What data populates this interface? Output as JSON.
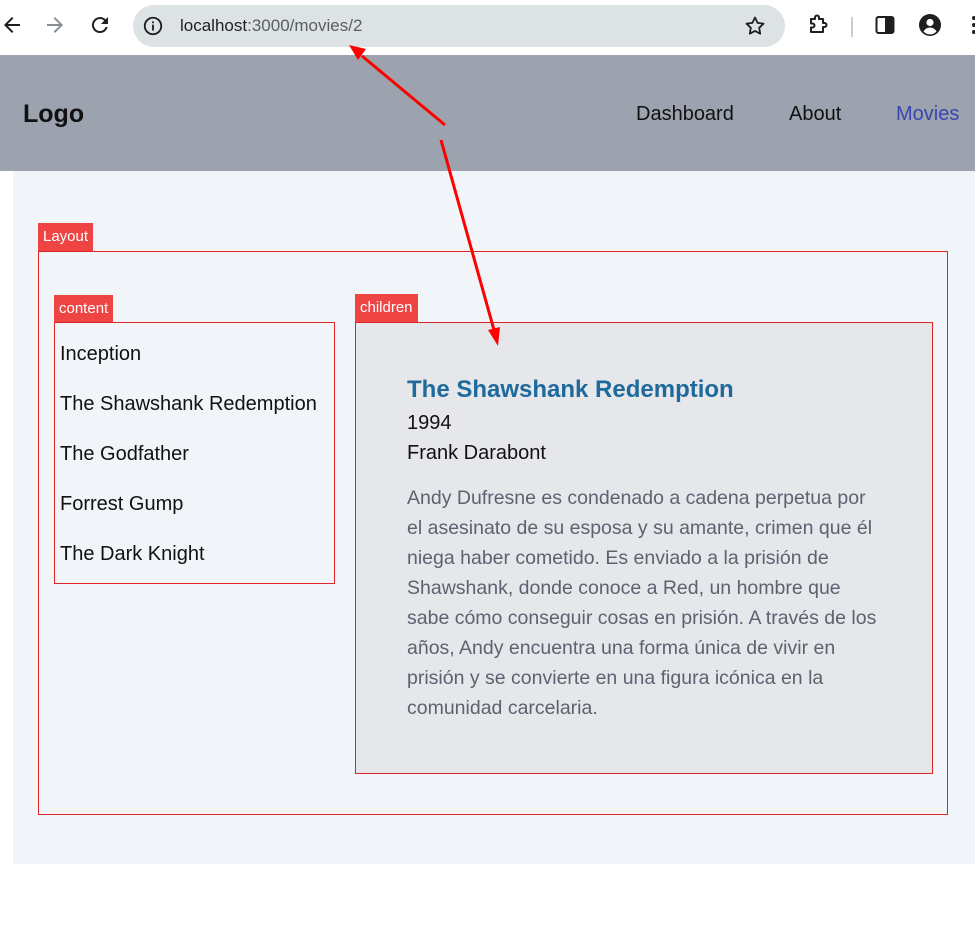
{
  "browser": {
    "url_host": "localhost",
    "url_path": ":3000/movies/2"
  },
  "header": {
    "logo": "Logo",
    "nav": [
      {
        "label": "Dashboard"
      },
      {
        "label": "About"
      },
      {
        "label": "Movies"
      }
    ]
  },
  "layout": {
    "layout_tag": "Layout",
    "content_tag": "content",
    "children_tag": "children"
  },
  "movie_list": [
    "Inception",
    "The Shawshank Redemption",
    "The Godfather",
    "Forrest Gump",
    "The Dark Knight"
  ],
  "movie_detail": {
    "title": "The Shawshank Redemption",
    "year": "1994",
    "director": "Frank Darabont",
    "description": "Andy Dufresne es condenado a cadena perpetua por el asesinato de su esposa y su amante, crimen que él niega haber cometido. Es enviado a la prisión de Shawshank, donde conoce a Red, un hombre que sabe cómo conseguir cosas en prisión. A través de los años, Andy encuentra una forma única de vivir en prisión y se convierte en una figura icónica en la comunidad carcelaria."
  },
  "colors": {
    "header_bg": "#9ca3af",
    "active_nav": "#3b45b0",
    "tag_bg": "#ef4444",
    "border": "#dc2626",
    "title": "#1e6a9c",
    "arrow": "#ff0000"
  }
}
